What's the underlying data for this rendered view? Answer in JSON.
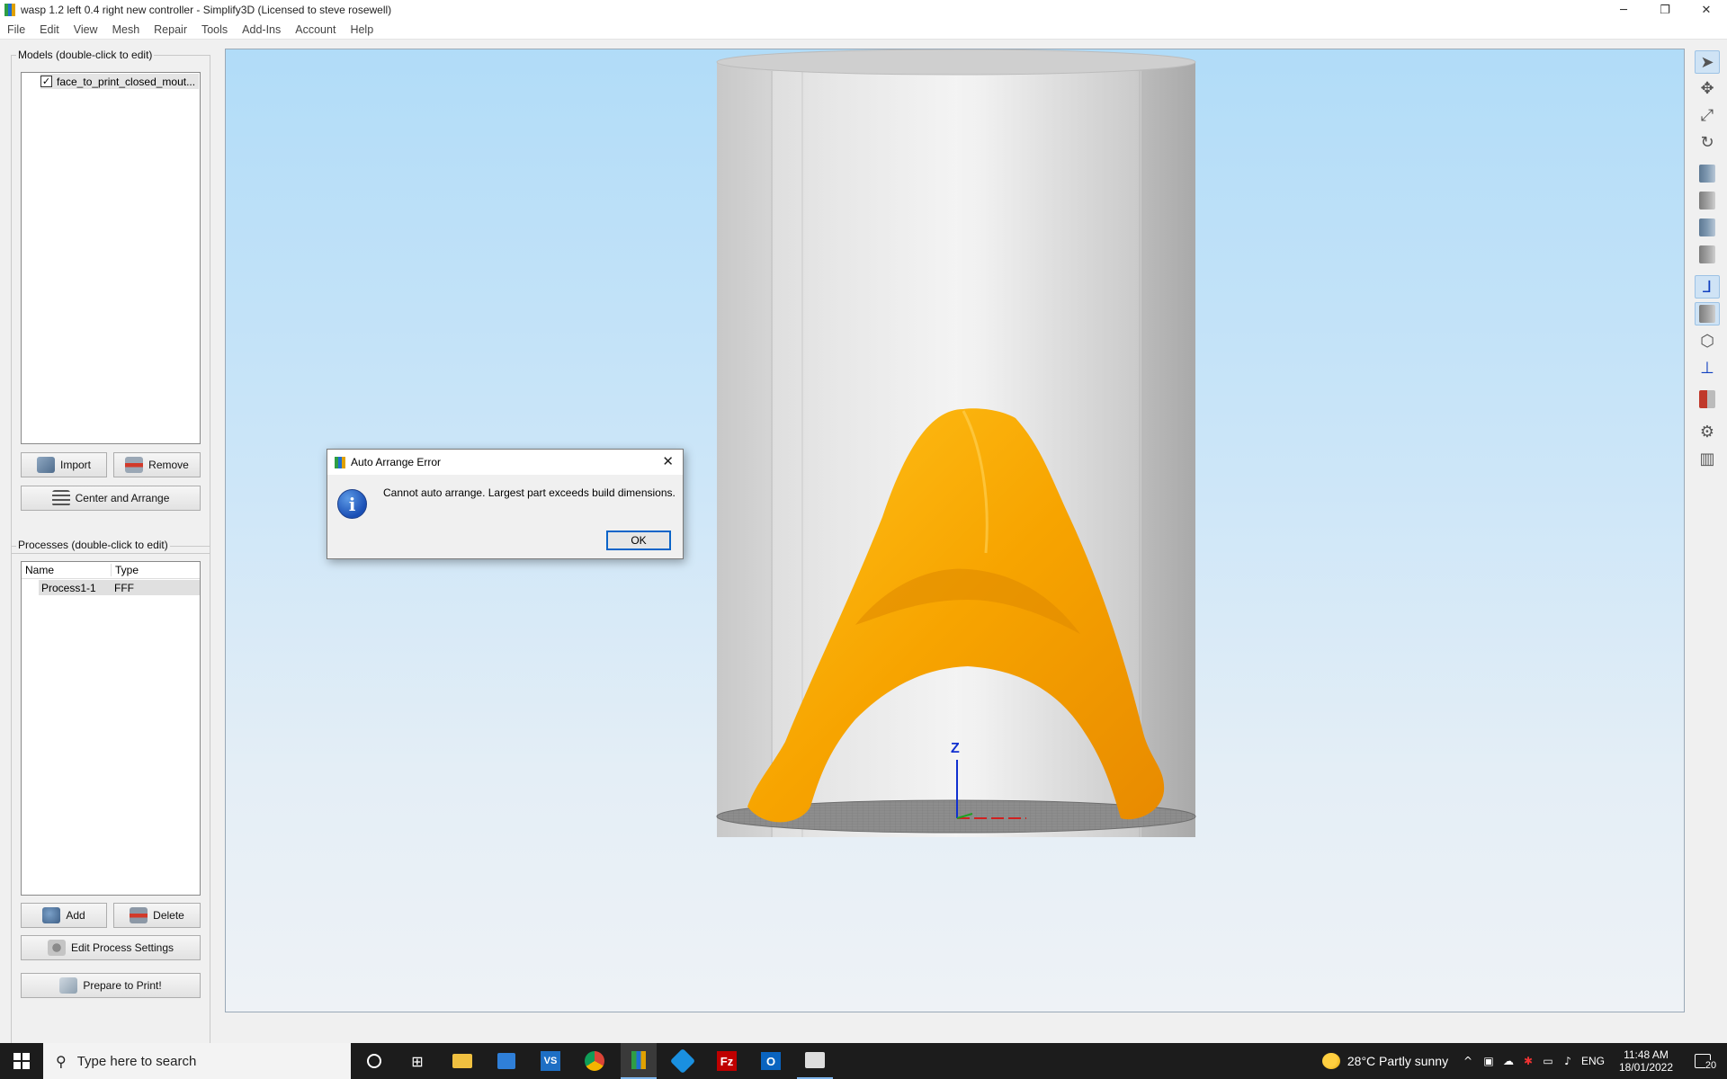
{
  "window": {
    "title": "wasp  1.2 left 0.4 right new controller - Simplify3D (Licensed to steve rosewell)",
    "controls": {
      "minimize": "─",
      "restore": "❐",
      "close": "✕"
    }
  },
  "menu": [
    "File",
    "Edit",
    "View",
    "Mesh",
    "Repair",
    "Tools",
    "Add-Ins",
    "Account",
    "Help"
  ],
  "models": {
    "title": "Models (double-click to edit)",
    "items": [
      {
        "checked": true,
        "label": "face_to_print_closed_mout..."
      }
    ],
    "import_label": "Import",
    "remove_label": "Remove",
    "center_label": "Center and Arrange"
  },
  "processes": {
    "title": "Processes (double-click to edit)",
    "columns": [
      "Name",
      "Type"
    ],
    "rows": [
      {
        "name": "Process1-1",
        "type": "FFF"
      }
    ],
    "add_label": "Add",
    "delete_label": "Delete",
    "edit_label": "Edit Process Settings",
    "prepare_label": "Prepare to Print!"
  },
  "viewport": {
    "axis_label": "Z",
    "model_color": "#f7a400",
    "build_volume_color": "#d2d2d2"
  },
  "dialog": {
    "title": "Auto Arrange Error",
    "message": "Cannot auto arrange.  Largest part exceeds build dimensions.",
    "ok_label": "OK",
    "close_glyph": "✕",
    "info_glyph": "i"
  },
  "right_tools": [
    "select-icon",
    "move-icon",
    "scale-icon",
    "rotate-icon",
    "view-iso-icon",
    "view-front-icon",
    "view-top-icon",
    "view-side-icon",
    "axes-icon",
    "solid-view-icon",
    "wireframe-icon",
    "normals-icon",
    "cross-section-icon",
    "settings-icon",
    "supports-icon"
  ],
  "taskbar": {
    "search_placeholder": "Type here to search",
    "weather": "28°C  Partly sunny",
    "language": "ENG",
    "time": "11:48 AM",
    "date": "18/01/2022",
    "notification_count": "20"
  }
}
